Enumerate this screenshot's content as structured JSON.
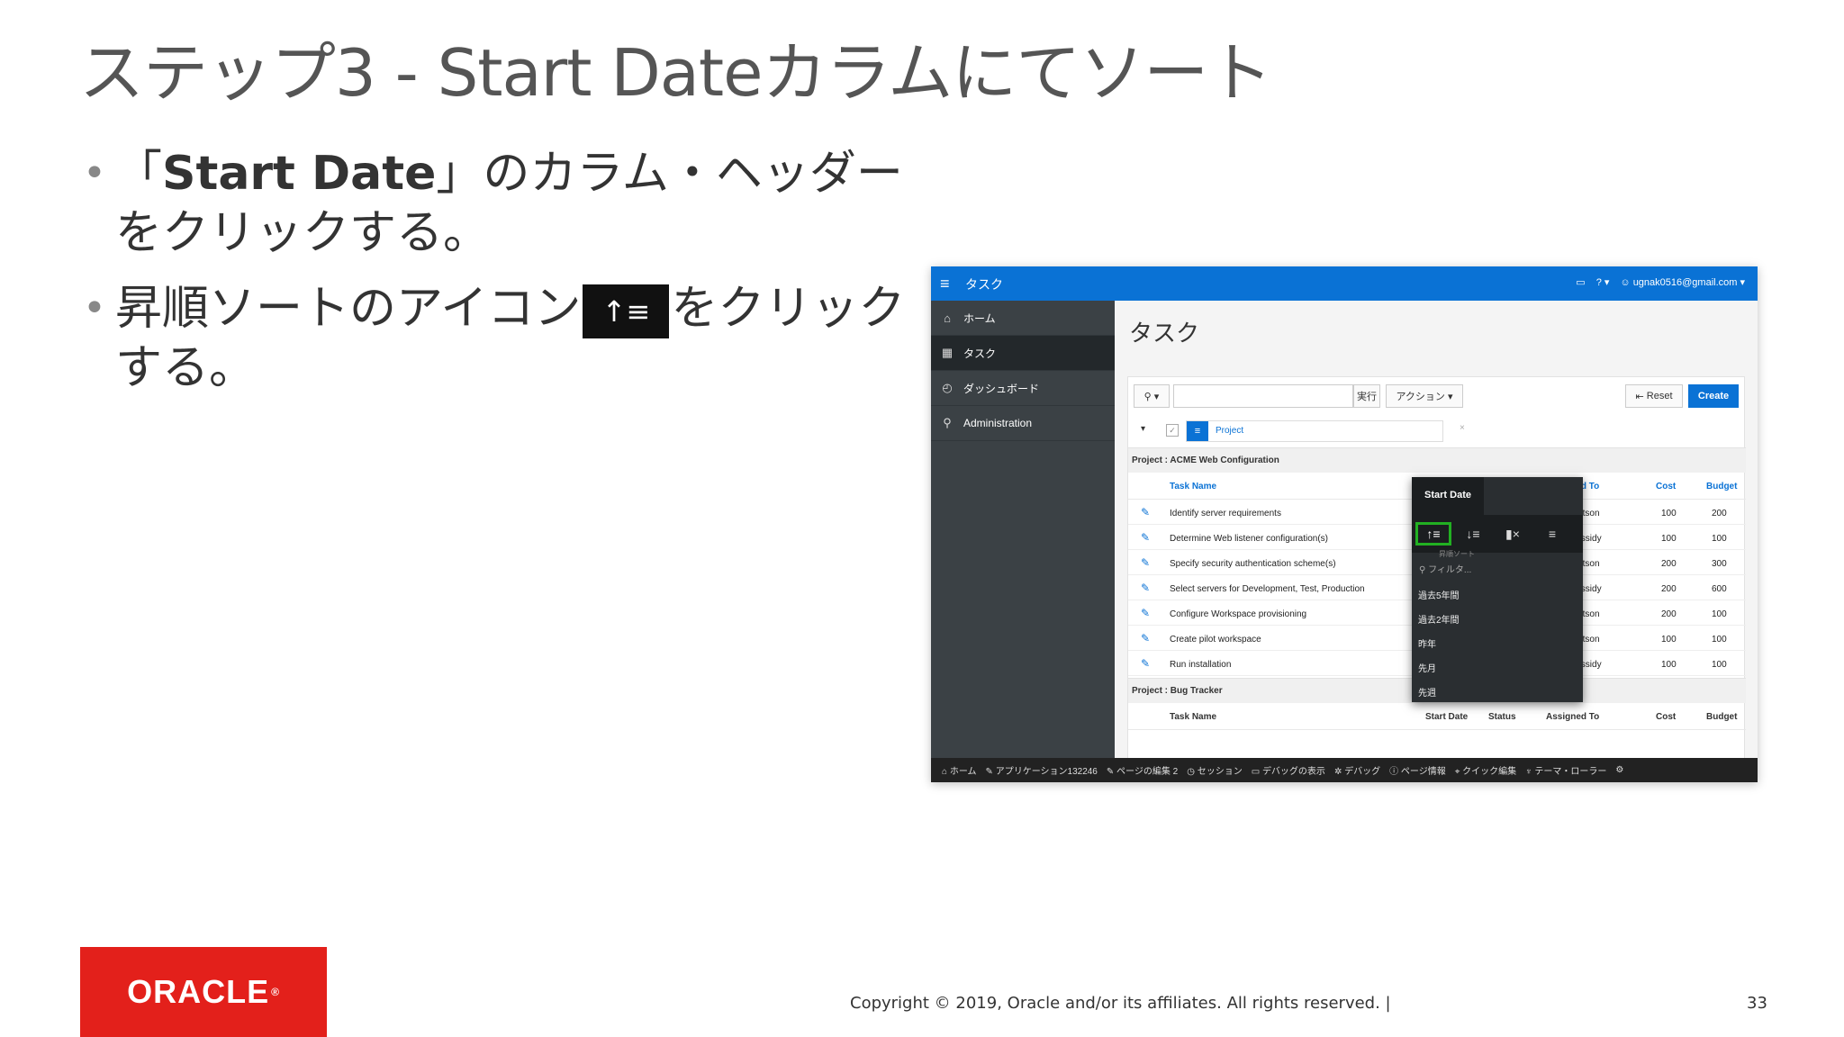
{
  "slide": {
    "title": "ステップ3 - Start Dateカラムにてソート",
    "bullet1_pre": "「",
    "bullet1_bold": "Start Date",
    "bullet1_post": "」のカラム・ヘッダーをクリックする。",
    "bullet2_pre": "昇順ソートのアイコン",
    "bullet2_icon": "↑≡",
    "bullet2_post": "をクリックする。",
    "copyright": "Copyright © 2019, Oracle and/or its affiliates. All rights reserved.  |",
    "page_number": "33",
    "logo_text": "ORACLE",
    "logo_mark": "®"
  },
  "app": {
    "name": "タスク",
    "user": "ugnak0516@gmail.com",
    "sidebar": [
      {
        "label": "ホーム",
        "icon": "home-icon"
      },
      {
        "label": "タスク",
        "icon": "table-icon"
      },
      {
        "label": "ダッシュボード",
        "icon": "dashboard-icon"
      },
      {
        "label": "Administration",
        "icon": "admin-icon"
      }
    ],
    "page_title": "タスク",
    "toolbar": {
      "go": "実行",
      "actions": "アクション",
      "reset": "Reset",
      "create": "Create"
    },
    "filter_label": "Project",
    "groups": [
      {
        "label": "Project : ACME Web Configuration"
      },
      {
        "label": "Project : Bug Tracker"
      }
    ],
    "columns": [
      "Task Name",
      "Start Date",
      "Status",
      "Assigned To",
      "Cost",
      "Budget"
    ],
    "rows": [
      {
        "task": "Identify server requirements",
        "assigned": "Watson",
        "cost": "100",
        "budget": "200"
      },
      {
        "task": "Determine Web listener configuration(s)",
        "assigned": "Cassidy",
        "cost": "100",
        "budget": "100"
      },
      {
        "task": "Specify security authentication scheme(s)",
        "assigned": "Watson",
        "cost": "200",
        "budget": "300"
      },
      {
        "task": "Select servers for Development, Test, Production",
        "assigned": "Cassidy",
        "cost": "200",
        "budget": "600"
      },
      {
        "task": "Configure Workspace provisioning",
        "assigned": "Watson",
        "cost": "200",
        "budget": "100"
      },
      {
        "task": "Create pilot workspace",
        "assigned": "Watson",
        "cost": "100",
        "budget": "100"
      },
      {
        "task": "Run installation",
        "assigned": "Cassidy",
        "cost": "100",
        "budget": "100"
      }
    ],
    "popup": {
      "header": "Start Date",
      "tooltip": "昇順ソート",
      "search_placeholder": "フィルタ...",
      "options": [
        "過去5年間",
        "過去2年間",
        "昨年",
        "先月",
        "先週"
      ]
    },
    "devbar": [
      "ホーム",
      "アプリケーション132246",
      "ページの編集 2",
      "セッション",
      "デバッグの表示",
      "デバッグ",
      "ページ情報",
      "クイック編集",
      "テーマ・ローラー"
    ]
  }
}
